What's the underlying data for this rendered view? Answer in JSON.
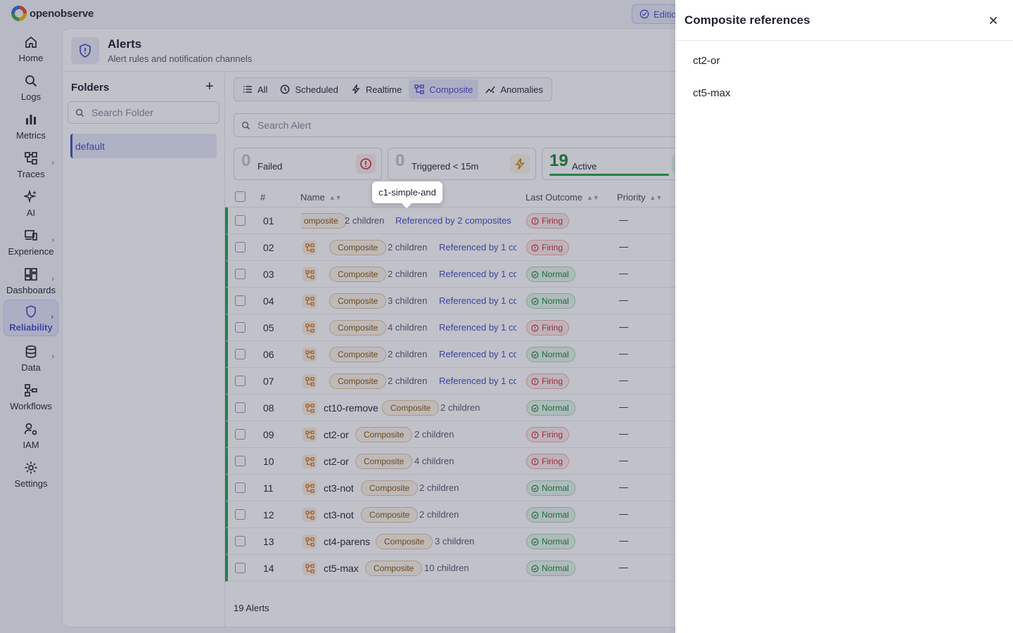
{
  "app": {
    "logo_text": "openobserve",
    "edition_label": "Editio"
  },
  "nav": [
    {
      "label": "Home",
      "icon": "home-icon"
    },
    {
      "label": "Logs",
      "icon": "search-icon"
    },
    {
      "label": "Metrics",
      "icon": "bar-chart-icon"
    },
    {
      "label": "Traces",
      "icon": "traces-icon"
    },
    {
      "label": "AI",
      "icon": "sparkle-icon"
    },
    {
      "label": "Experience",
      "icon": "devices-icon"
    },
    {
      "label": "Dashboards",
      "icon": "dashboard-icon"
    },
    {
      "label": "Reliability",
      "icon": "shield-icon"
    },
    {
      "label": "Data",
      "icon": "database-icon"
    },
    {
      "label": "Workflows",
      "icon": "workflow-icon"
    },
    {
      "label": "IAM",
      "icon": "user-gear-icon"
    },
    {
      "label": "Settings",
      "icon": "gear-icon"
    }
  ],
  "page": {
    "title": "Alerts",
    "subtitle": "Alert rules and notification channels"
  },
  "folders": {
    "title": "Folders",
    "search_placeholder": "Search Folder",
    "items": [
      "default"
    ]
  },
  "tabs": [
    "All",
    "Scheduled",
    "Realtime",
    "Composite",
    "Anomalies"
  ],
  "alert_search_placeholder": "Search Alert",
  "stats": {
    "failed": {
      "value": "0",
      "label": "Failed"
    },
    "triggered": {
      "value": "0",
      "label": "Triggered < 15m"
    },
    "active": {
      "value": "19",
      "label": "Active"
    }
  },
  "table": {
    "headers": {
      "num": "#",
      "name": "Name",
      "last_outcome": "Last Outcome",
      "priority": "Priority"
    },
    "rows": [
      {
        "num": "01",
        "name": "",
        "badge": "omposite",
        "children": "2 children",
        "refs": "Referenced by 2 composites",
        "outcome": "Firing",
        "priority": "—"
      },
      {
        "num": "02",
        "name": "",
        "badge": "Composite",
        "children": "2 children",
        "refs": "Referenced by 1 co",
        "outcome": "Firing",
        "priority": "—"
      },
      {
        "num": "03",
        "name": "",
        "badge": "Composite",
        "children": "2 children",
        "refs": "Referenced by 1 co",
        "outcome": "Normal",
        "priority": "—"
      },
      {
        "num": "04",
        "name": "",
        "badge": "Composite",
        "children": "3 children",
        "refs": "Referenced by 1 co",
        "outcome": "Normal",
        "priority": "—"
      },
      {
        "num": "05",
        "name": "",
        "badge": "Composite",
        "children": "4 children",
        "refs": "Referenced by 1 co",
        "outcome": "Firing",
        "priority": "—"
      },
      {
        "num": "06",
        "name": "",
        "badge": "Composite",
        "children": "2 children",
        "refs": "Referenced by 1 co",
        "outcome": "Normal",
        "priority": "—"
      },
      {
        "num": "07",
        "name": "",
        "badge": "Composite",
        "children": "2 children",
        "refs": "Referenced by 1 co",
        "outcome": "Firing",
        "priority": "—"
      },
      {
        "num": "08",
        "name": "ct10-remove",
        "badge": "Composite",
        "children": "2 children",
        "refs": "",
        "outcome": "Normal",
        "priority": "—"
      },
      {
        "num": "09",
        "name": "ct2-or",
        "badge": "Composite",
        "children": "2 children",
        "refs": "",
        "outcome": "Firing",
        "priority": "—"
      },
      {
        "num": "10",
        "name": "ct2-or",
        "badge": "Composite",
        "children": "4 children",
        "refs": "",
        "outcome": "Firing",
        "priority": "—"
      },
      {
        "num": "11",
        "name": "ct3-not",
        "badge": "Composite",
        "children": "2 children",
        "refs": "",
        "outcome": "Normal",
        "priority": "—"
      },
      {
        "num": "12",
        "name": "ct3-not",
        "badge": "Composite",
        "children": "2 children",
        "refs": "",
        "outcome": "Normal",
        "priority": "—"
      },
      {
        "num": "13",
        "name": "ct4-parens",
        "badge": "Composite",
        "children": "3 children",
        "refs": "",
        "outcome": "Normal",
        "priority": "—"
      },
      {
        "num": "14",
        "name": "ct5-max",
        "badge": "Composite",
        "children": "10 children",
        "refs": "",
        "outcome": "Normal",
        "priority": "—"
      }
    ]
  },
  "footer": {
    "count": "19 Alerts"
  },
  "tooltip": {
    "text": "c1-simple-and"
  },
  "drawer": {
    "title": "Composite references",
    "items": [
      "ct2-or",
      "ct5-max"
    ]
  },
  "colors": {
    "accent": "#4b52c4",
    "active_green": "#2da44e",
    "firing_red": "#c93434",
    "composite_orange": "#e07b1a"
  }
}
